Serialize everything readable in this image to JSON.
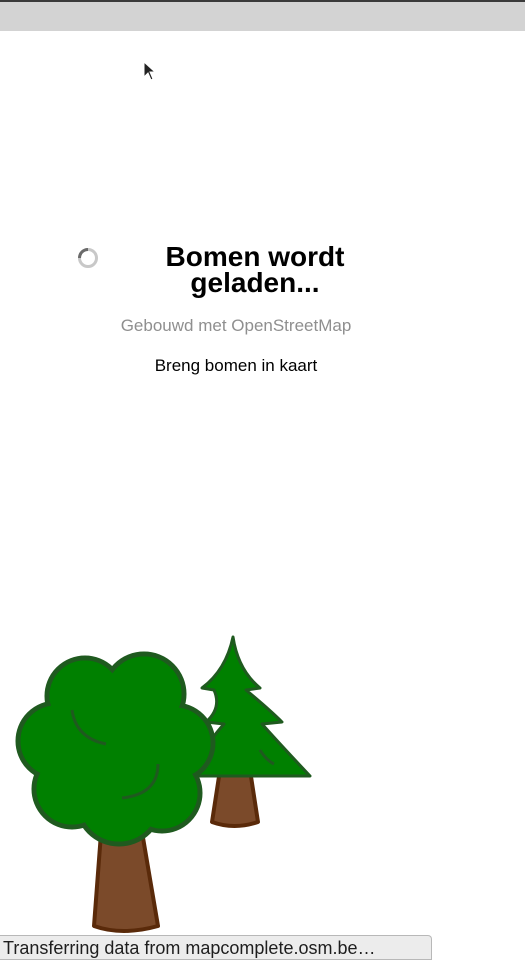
{
  "loading": {
    "title": "Bomen wordt geladen...",
    "subtitle": "Gebouwd met OpenStreetMap",
    "description": "Breng bomen in kaart"
  },
  "icons": {
    "spinner": "loading-spinner-icon",
    "cursor": "mouse-pointer-icon",
    "trees": "trees-logo"
  },
  "status_bar": {
    "text": "Transferring data from mapcomplete.osm.be…"
  },
  "colors": {
    "top_strip": "#d3d3d3",
    "tree_green": "#008000",
    "tree_outline": "#1f5a1f",
    "trunk_brown": "#7b4a2a",
    "trunk_outline": "#5a2a0a",
    "subtitle_gray": "#8f8f8f"
  }
}
